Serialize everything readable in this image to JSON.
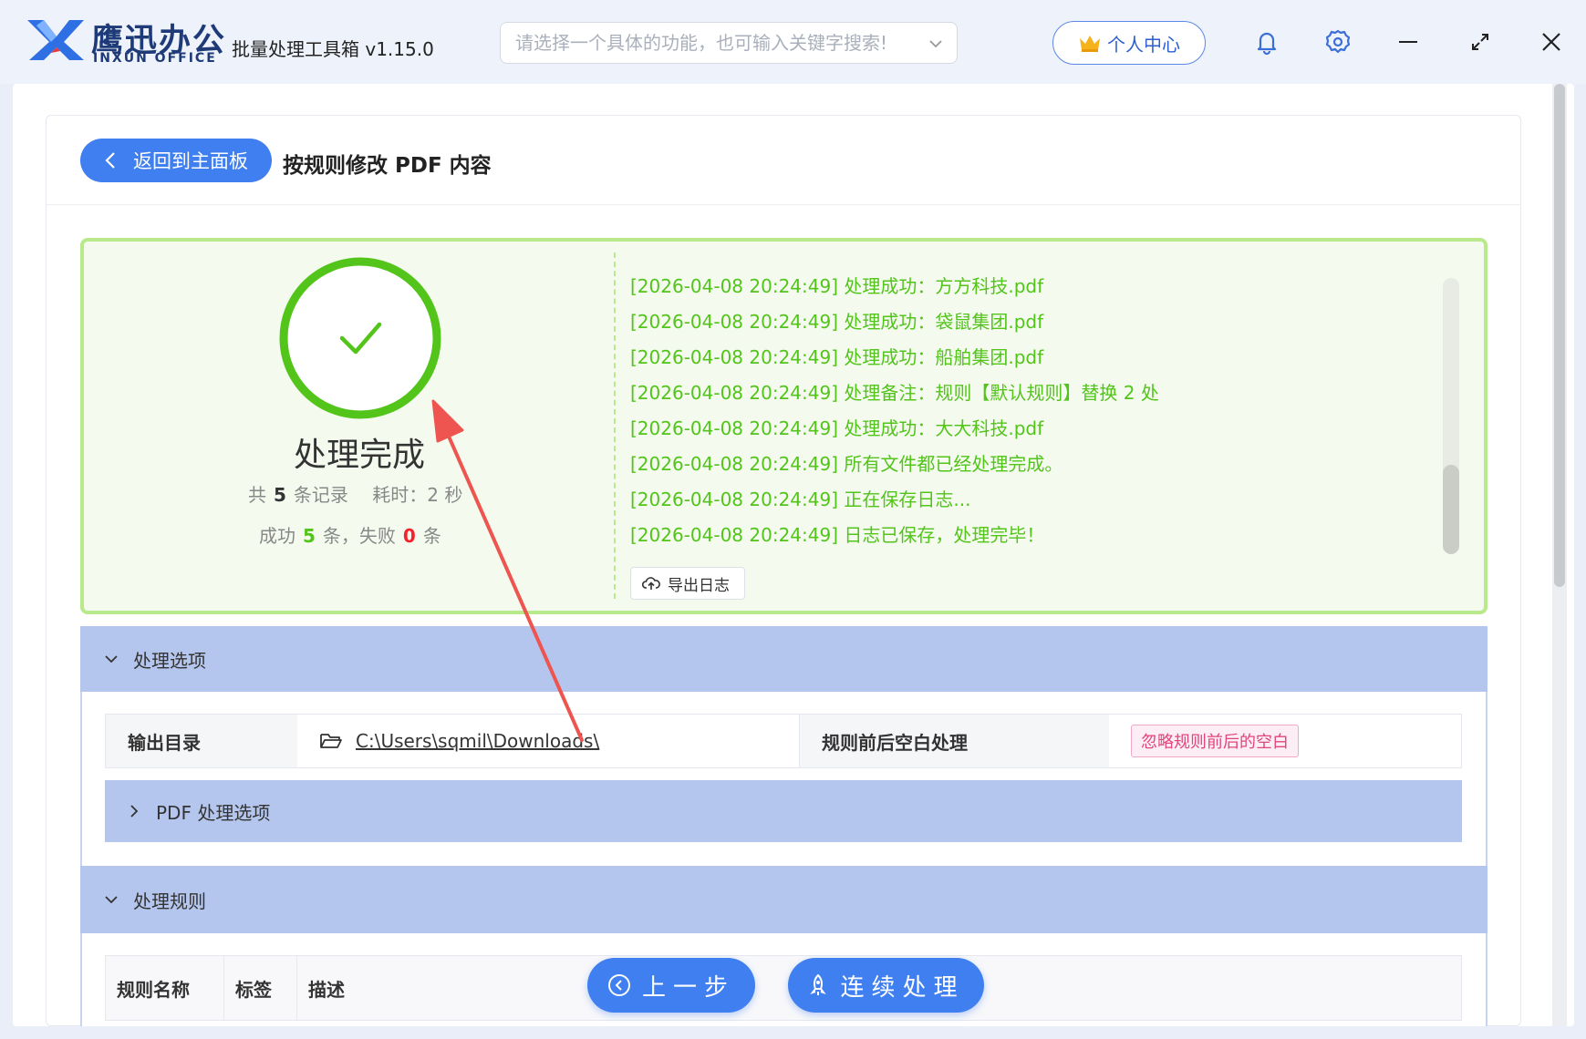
{
  "app": {
    "brand_cn": "鹰迅办公",
    "brand_en": "INXUN OFFICE",
    "title": "批量处理工具箱 v1.15.0",
    "search_placeholder": "请选择一个具体的功能，也可输入关键字搜索!",
    "user_center_label": "个人中心",
    "icons": [
      "logo-icon",
      "chevron-down-icon",
      "crown-icon",
      "bell-icon",
      "gear-icon",
      "minimize-icon",
      "maximize-icon",
      "close-icon"
    ]
  },
  "page": {
    "back_label": "返回到主面板",
    "title": "按规则修改 PDF 内容"
  },
  "result": {
    "status": "处理完成",
    "total_prefix": "共",
    "total_count": "5",
    "total_suffix": "条记录",
    "elapsed_label": "耗时：",
    "elapsed_value": "2 秒",
    "success_prefix": "成功",
    "success_count": "5",
    "success_suffix": "条，失败",
    "fail_count": "0",
    "fail_suffix": "条",
    "colors": {
      "success": "#52c41a",
      "fail": "#f5222d",
      "panel_border": "#b8ea8c"
    }
  },
  "log": {
    "lines": [
      "[2026-04-08 20:24:49] 处理成功：方方科技.pdf",
      "[2026-04-08 20:24:49] 处理成功：袋鼠集团.pdf",
      "[2026-04-08 20:24:49] 处理成功：船舶集团.pdf",
      "[2026-04-08 20:24:49] 处理备注：规则【默认规则】替换 2 处",
      "[2026-04-08 20:24:49] 处理成功：大大科技.pdf",
      "[2026-04-08 20:24:49] 所有文件都已经处理完成。",
      "[2026-04-08 20:24:49] 正在保存日志...",
      "[2026-04-08 20:24:49] 日志已保存，处理完毕！"
    ],
    "export_label": "导出日志"
  },
  "options": {
    "section_title": "处理选项",
    "output_dir_label": "输出目录",
    "output_dir_value": "C:\\Users\\sqmil\\Downloads\\",
    "whitespace_label": "规则前后空白处理",
    "whitespace_value": "忽略规则前后的空白",
    "pdf_options_title": "PDF 处理选项"
  },
  "rules": {
    "section_title": "处理规则",
    "columns": [
      "规则名称",
      "标签",
      "描述"
    ]
  },
  "actions": {
    "prev_label": "上一步",
    "continue_label": "连续处理"
  }
}
